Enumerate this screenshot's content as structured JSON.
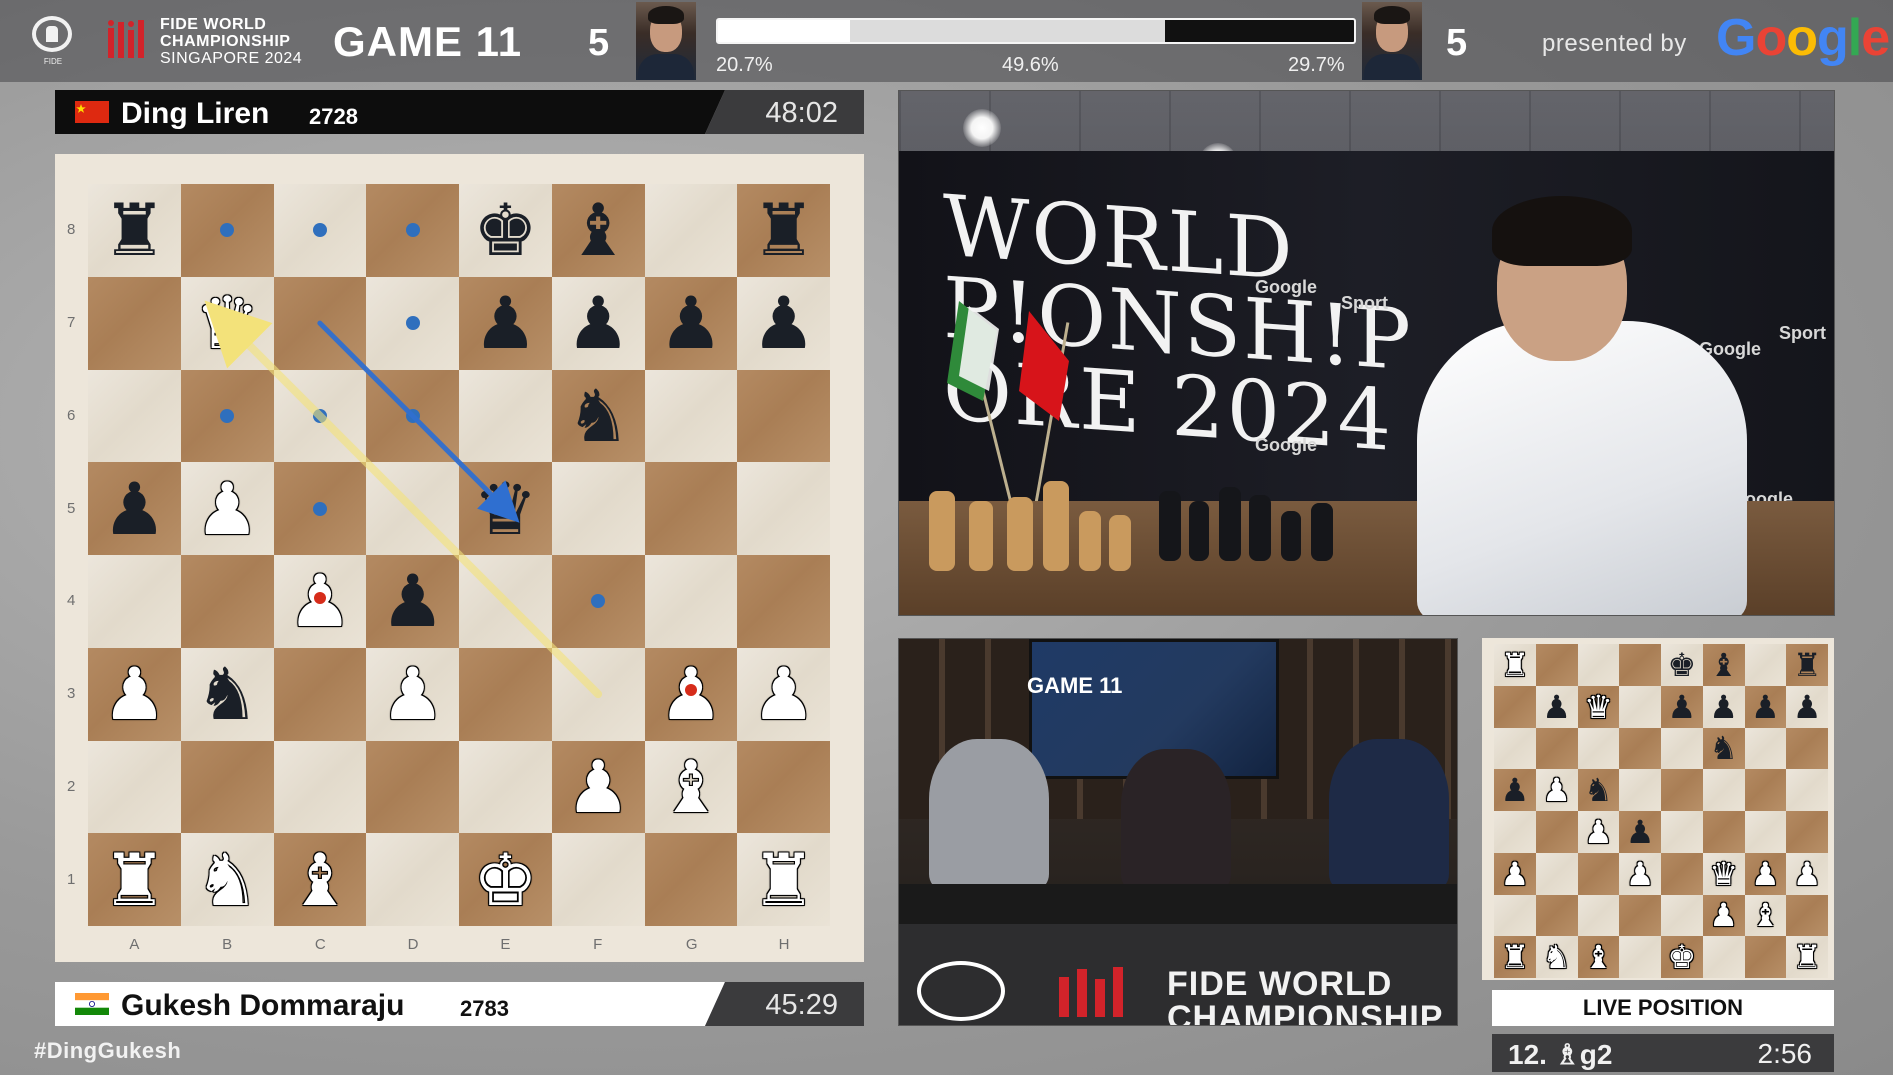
{
  "header": {
    "logo_caption": "FIDE",
    "event_title": [
      "FIDE WORLD",
      "CHAMPIONSHIP",
      "SINGAPORE 2024"
    ],
    "game": "GAME 11",
    "score_left": "5",
    "score_right": "5",
    "eval": {
      "white_pct": "20.7%",
      "draw_pct": "49.6%",
      "black_pct": "29.7%",
      "white_fraction": 0.207,
      "black_fraction": 0.297
    },
    "presented_by": "presented by",
    "sponsor": [
      "G",
      "o",
      "o",
      "g",
      "l",
      "e"
    ],
    "sponsor_colors": [
      "#4285F4",
      "#EA4335",
      "#FBBC05",
      "#4285F4",
      "#34A853",
      "#EA4335"
    ]
  },
  "top_player": {
    "name": "Ding Liren",
    "rating": "2728",
    "clock": "48:02",
    "flag": "china"
  },
  "bottom_player": {
    "name": "Gukesh Dommaraju",
    "rating": "2783",
    "clock": "45:29",
    "flag": "india"
  },
  "board": {
    "ranks": [
      "8",
      "7",
      "6",
      "5",
      "4",
      "3",
      "2",
      "1"
    ],
    "files": [
      "A",
      "B",
      "C",
      "D",
      "E",
      "F",
      "G",
      "H"
    ],
    "position": [
      [
        "bR",
        "",
        "",
        "",
        "bK",
        "bB",
        "",
        "bR"
      ],
      [
        "",
        "wQ",
        "",
        "",
        "bP",
        "bP",
        "bP",
        "bP"
      ],
      [
        "",
        "",
        "",
        "",
        "",
        "bN",
        "",
        ""
      ],
      [
        "bP",
        "wP",
        "",
        "",
        "bQ",
        "",
        "",
        ""
      ],
      [
        "",
        "",
        "wP",
        "bP",
        "",
        "",
        "",
        ""
      ],
      [
        "wP",
        "bN",
        "",
        "wP",
        "",
        "",
        "wP",
        "wP"
      ],
      [
        "",
        "",
        "",
        "",
        "",
        "wP",
        "wB",
        ""
      ],
      [
        "wR",
        "wN",
        "wB",
        "",
        "wK",
        "",
        "",
        "wR"
      ]
    ],
    "move_dots": [
      [
        0,
        1
      ],
      [
        0,
        2
      ],
      [
        0,
        3
      ],
      [
        1,
        3
      ],
      [
        2,
        1
      ],
      [
        2,
        2
      ],
      [
        2,
        3
      ],
      [
        3,
        2
      ],
      [
        4,
        5
      ]
    ],
    "red_marks": [
      [
        1,
        1
      ],
      [
        4,
        2
      ],
      [
        5,
        6
      ]
    ],
    "arrows": [
      {
        "from": [
          1,
          2
        ],
        "to": [
          3,
          4
        ],
        "color": "#2f6fd0"
      },
      {
        "from": [
          5,
          5
        ],
        "to": [
          1,
          1
        ],
        "color": "#f3e27a"
      }
    ]
  },
  "camera": {
    "backdrop_text": [
      "WORLD",
      "P!ONSH!P",
      "ORE 2024"
    ],
    "sponsors": [
      "Google",
      "Sport",
      "Google",
      "Google",
      "Sport",
      "Google"
    ]
  },
  "studio": {
    "tv_title": "GAME 11",
    "banner": [
      "FIDE WORLD",
      "CHAMPIONSHIP"
    ]
  },
  "live": {
    "label": "LIVE POSITION",
    "move": "12. ♗g2",
    "clock": "2:56",
    "position": [
      [
        "wR",
        "",
        "",
        "",
        "bK",
        "bB",
        "",
        "bR"
      ],
      [
        "",
        "bP",
        "wQ",
        "",
        "bP",
        "bP",
        "bP",
        "bP"
      ],
      [
        "",
        "",
        "",
        "",
        "",
        "bN",
        "",
        ""
      ],
      [
        "bP",
        "wP",
        "bN",
        "",
        "",
        "",
        "",
        ""
      ],
      [
        "",
        "",
        "wP",
        "bP",
        "",
        "",
        "",
        ""
      ],
      [
        "wP",
        "",
        "",
        "wP",
        "",
        "wQ",
        "wP",
        "wP"
      ],
      [
        "",
        "",
        "",
        "",
        "",
        "wP",
        "wB",
        ""
      ],
      [
        "wR",
        "wN",
        "wB",
        "",
        "wK",
        "",
        "",
        "wR"
      ]
    ]
  },
  "hashtag": "#DingGukesh",
  "piece_glyphs": {
    "K": "♚",
    "Q": "♛",
    "R": "♜",
    "B": "♝",
    "N": "♞",
    "P": "♟"
  }
}
